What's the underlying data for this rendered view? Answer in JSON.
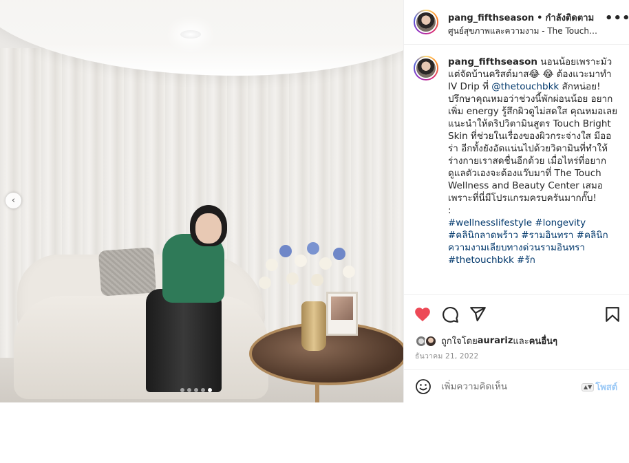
{
  "post": {
    "username": "pang_fifthseason",
    "follow_status": "กำลังติดตาม",
    "location": "ศูนย์สุขภาพและความงาม - The Touch Wellness and Beauty Center",
    "more_label": "•••"
  },
  "caption": {
    "username": "pang_fifthseason",
    "text_1": "นอนน้อยเพราะมัวแต่จัดบ้านคริสต์มาส😂 😂 ต้องแวะมาทำ IV Drip ที่ ",
    "mention": "@thetouchbkk",
    "text_2": " สักหน่อย! ปรึกษาคุณหมอว่าช่วงนี้พักผ่อนน้อย อยากเพิ่ม energy รู้สึกผิวดูไม่สดใส คุณหมอเลยแนะนำให้ดริปวิตามินสูตร Touch Bright Skin ที่ช่วยในเรื่องของผิวกระจ่างใส มีออร่า อีกทั้งยังอัดแน่นไปด้วยวิตามินที่ทำให้ร่างกายเราสดชื่นอีกด้วย เมื่อไหร่ที่อยากดูแลตัวเองจะต้องแว๊บมาที่ The Touch Wellness and Beauty Center เสมอ เพราะที่นี่มีโปรแกรมครบครันมากกั๊บ!",
    "separator": ":",
    "hashtags": "#wellnesslifestyle #longevity #คลินิกลาดพร้าว #รามอินทรา #คลินิกความงามเลียบทางด่วนรามอินทรา #thetouchbkk #รัก"
  },
  "actions": {
    "likes_prefix": "ถูกใจโดย ",
    "likes_user": "aurariz",
    "likes_and": " และ",
    "likes_others": "คนอื่นๆ",
    "date": "ธันวาคม 21, 2022"
  },
  "comment": {
    "placeholder": "เพิ่มความคิดเห็น",
    "post_label": "โพสต์",
    "post_arrow": "▲▼"
  },
  "carousel": {
    "prev_icon": "‹",
    "slide_count": 5,
    "active_slide": 5
  },
  "colors": {
    "like_red": "#ed4956",
    "link_blue": "#00376b",
    "post_button_disabled": "#9bc9f6"
  }
}
